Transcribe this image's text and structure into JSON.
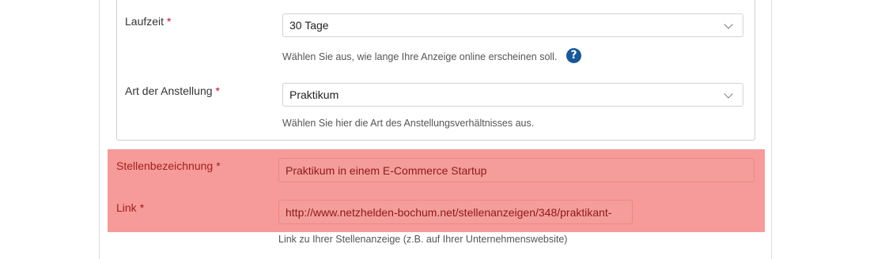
{
  "fields": {
    "laufzeit": {
      "label": "Laufzeit",
      "required_mark": "*",
      "value": "30 Tage",
      "help": "Wählen Sie aus, wie lange Ihre Anzeige online erscheinen soll.",
      "help_icon": "question-circle-icon"
    },
    "anstellung": {
      "label": "Art der Anstellung",
      "required_mark": "*",
      "value": "Praktikum",
      "help": "Wählen Sie hier die Art des Anstellungsverhältnisses aus."
    },
    "stellenbezeichnung": {
      "label": "Stellenbezeichnung",
      "required_mark": "*",
      "value": "Praktikum in einem E-Commerce Startup"
    },
    "link": {
      "label": "Link",
      "required_mark": "*",
      "value": "http://www.netzhelden-bochum.net/stellenanzeigen/348/praktikant-",
      "help": "Link zu Ihrer Stellenanzeige (z.B. auf Ihrer Unternehmenswebsite)"
    }
  },
  "colors": {
    "error_background": "#f69b99",
    "error_text": "#a0201f",
    "required_mark": "#c0121c",
    "help_icon": "#16579a"
  }
}
